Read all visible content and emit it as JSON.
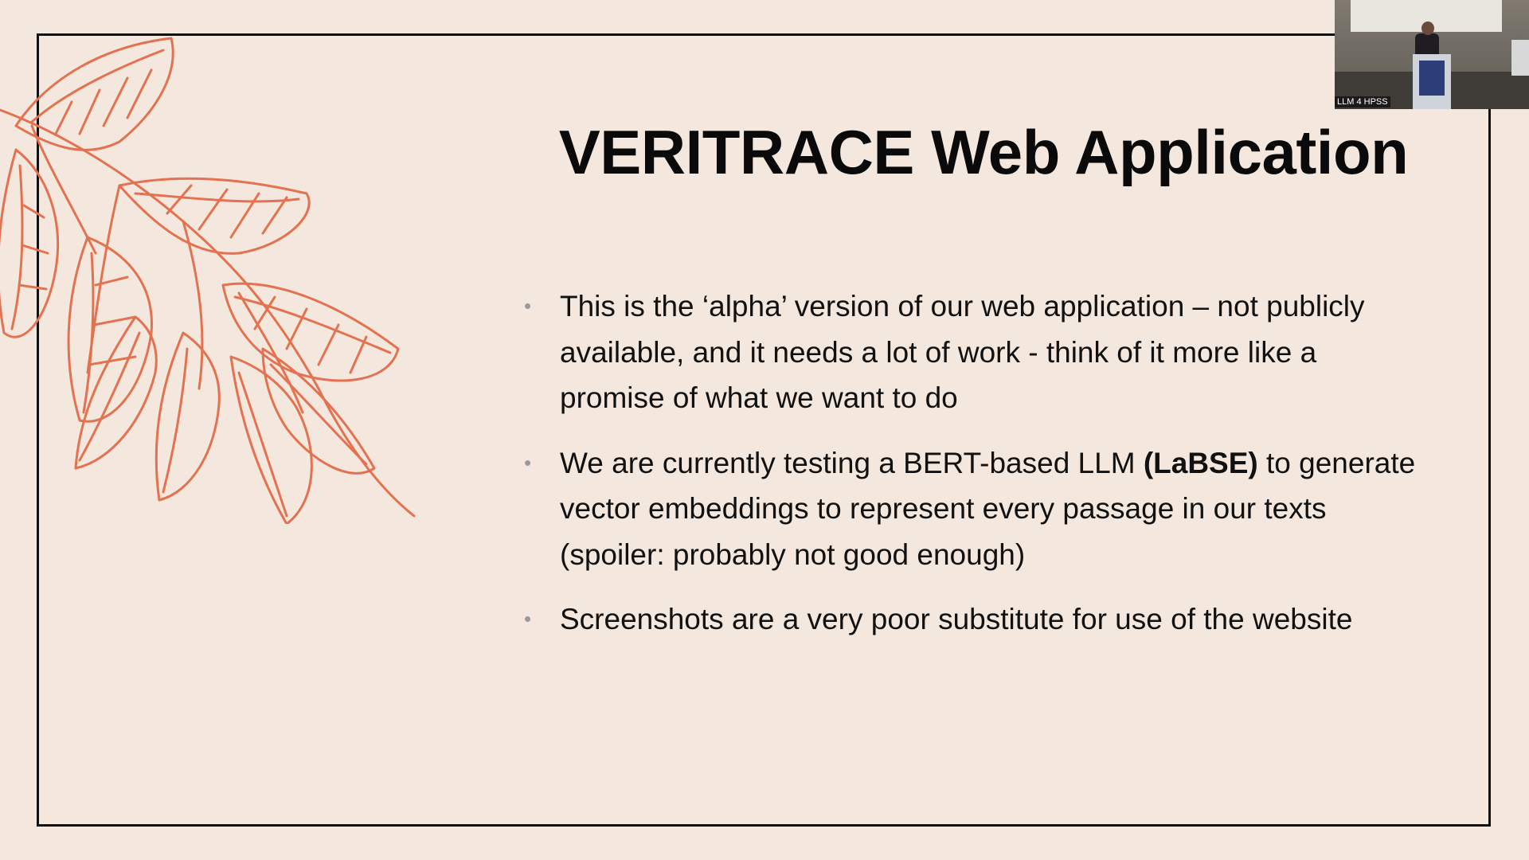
{
  "slide": {
    "title": "VERITRACE Web Application",
    "bullets": [
      {
        "before": "This is the ‘alpha’ version of our web application – not publicly available, and it needs a lot of work - think of it more like a promise of what we want to do",
        "bold": "",
        "after": ""
      },
      {
        "before": "We are currently testing a BERT-based LLM ",
        "bold": "(LaBSE)",
        "after": " to generate vector embeddings to represent every passage in our texts (spoiler: probably not good enough)"
      },
      {
        "before": "Screenshots are a very poor substitute for use of the website",
        "bold": "",
        "after": ""
      }
    ],
    "bullet_glyph": "•",
    "accent_color": "#e4714f",
    "background_color": "#f4e8de"
  },
  "video_overlay": {
    "label": "LLM 4 HPSS"
  }
}
